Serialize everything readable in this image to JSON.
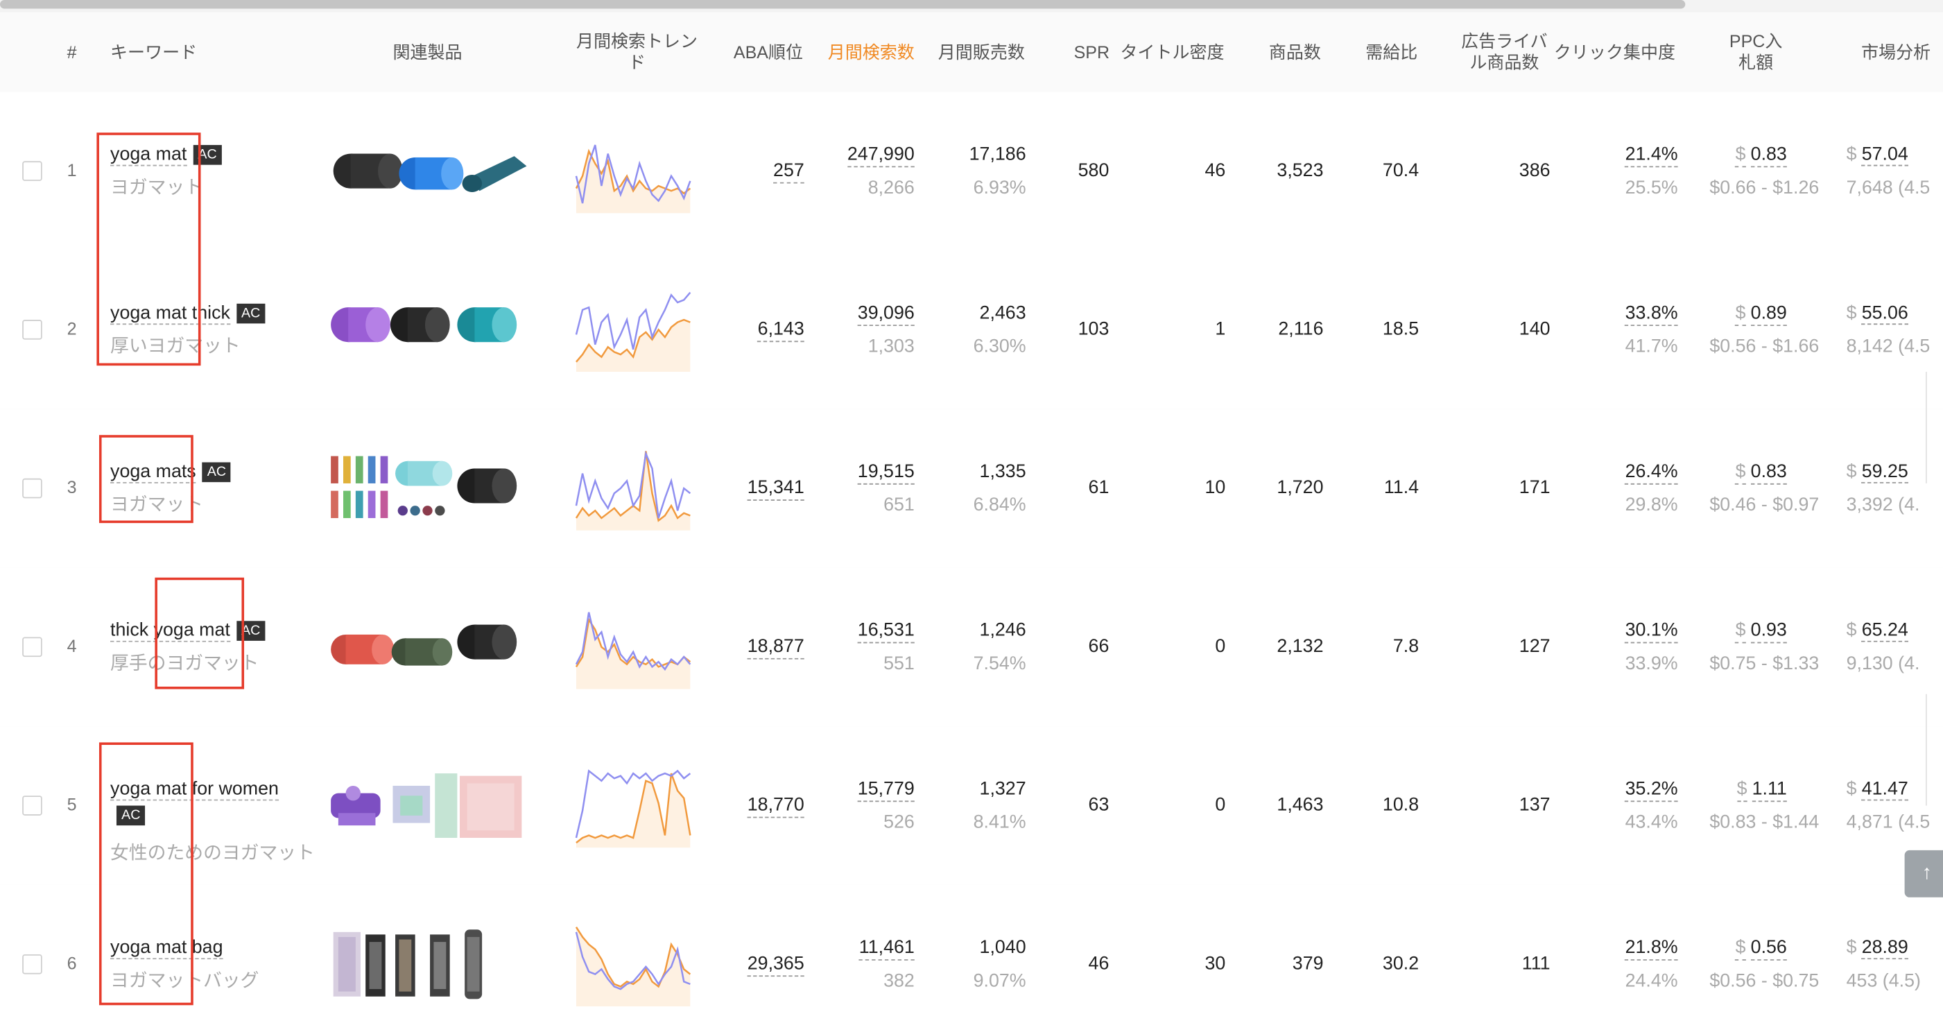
{
  "columns": {
    "num": "#",
    "keyword": "キーワード",
    "products": "関連製品",
    "trend": "月間検索トレンド",
    "aba": "ABA順位",
    "monthly_search": "月間検索数",
    "monthly_sales": "月間販売数",
    "spr": "SPR",
    "title_density": "タイトル密度",
    "product_count": "商品数",
    "supply_demand": "需給比",
    "ad_rivals": "広告ライバル商品数",
    "click_concentration": "クリック集中度",
    "ppc_bid": "PPC入札額",
    "market": "市場分析"
  },
  "colors": {
    "accent_orange": "#f08a24",
    "highlight_red": "#e63c2c",
    "series_blue": "#8f8ff0",
    "series_orange": "#f19a3e"
  },
  "rows": [
    {
      "num": "1",
      "kw_pre": "yoga mat",
      "kw_post": "",
      "ac": "AC",
      "jp": "ヨガマット",
      "aba": "257",
      "search": "247,990",
      "search_sub": "8,266",
      "sales": "17,186",
      "sales_pct": "6.93%",
      "spr": "580",
      "density": "46",
      "products": "3,523",
      "ratio": "70.4",
      "rivals": "386",
      "click": "21.4%",
      "click_sub": "25.5%",
      "ppc": "0.83",
      "ppc_range": "$0.66 - $1.26",
      "market": "57.04",
      "market_sub": "7,648 (4.5"
    },
    {
      "num": "2",
      "kw_pre": "yoga mat",
      "kw_post": " thick",
      "ac": "AC",
      "jp": "厚いヨガマット",
      "aba": "6,143",
      "search": "39,096",
      "search_sub": "1,303",
      "sales": "2,463",
      "sales_pct": "6.30%",
      "spr": "103",
      "density": "1",
      "products": "2,116",
      "ratio": "18.5",
      "rivals": "140",
      "click": "33.8%",
      "click_sub": "41.7%",
      "ppc": "0.89",
      "ppc_range": "$0.56 - $1.66",
      "market": "55.06",
      "market_sub": "8,142 (4.5"
    },
    {
      "num": "3",
      "kw_pre": "yoga mats",
      "kw_post": "",
      "ac": "AC",
      "jp": "ヨガマット",
      "aba": "15,341",
      "search": "19,515",
      "search_sub": "651",
      "sales": "1,335",
      "sales_pct": "6.84%",
      "spr": "61",
      "density": "10",
      "products": "1,720",
      "ratio": "11.4",
      "rivals": "171",
      "click": "26.4%",
      "click_sub": "29.8%",
      "ppc": "0.83",
      "ppc_range": "$0.46 - $0.97",
      "market": "59.25",
      "market_sub": "3,392 (4."
    },
    {
      "num": "4",
      "kw_pre": "thick yoga mat",
      "kw_post": "",
      "ac": "AC",
      "jp": "厚手のヨガマット",
      "aba": "18,877",
      "search": "16,531",
      "search_sub": "551",
      "sales": "1,246",
      "sales_pct": "7.54%",
      "spr": "66",
      "density": "0",
      "products": "2,132",
      "ratio": "7.8",
      "rivals": "127",
      "click": "30.1%",
      "click_sub": "33.9%",
      "ppc": "0.93",
      "ppc_range": "$0.75 - $1.33",
      "market": "65.24",
      "market_sub": "9,130 (4."
    },
    {
      "num": "5",
      "kw_pre": "yoga mat",
      "kw_post": " for women",
      "ac": "AC",
      "jp": "女性のためのヨガマット",
      "aba": "18,770",
      "search": "15,779",
      "search_sub": "526",
      "sales": "1,327",
      "sales_pct": "8.41%",
      "spr": "63",
      "density": "0",
      "products": "1,463",
      "ratio": "10.8",
      "rivals": "137",
      "click": "35.2%",
      "click_sub": "43.4%",
      "ppc": "1.11",
      "ppc_range": "$0.83 - $1.44",
      "market": "41.47",
      "market_sub": "4,871 (4.5"
    },
    {
      "num": "6",
      "kw_pre": "yoga mat",
      "kw_post": " bag",
      "ac": "",
      "jp": "ヨガマットバッグ",
      "aba": "29,365",
      "search": "11,461",
      "search_sub": "382",
      "sales": "1,040",
      "sales_pct": "9.07%",
      "spr": "46",
      "density": "30",
      "products": "379",
      "ratio": "30.2",
      "rivals": "111",
      "click": "21.8%",
      "click_sub": "24.4%",
      "ppc": "0.56",
      "ppc_range": "$0.56 - $0.75",
      "market": "28.89",
      "market_sub": "453 (4.5)"
    }
  ],
  "icons": {
    "back_to_top": "arrow-up-icon"
  },
  "back_to_top_glyph": "↑"
}
